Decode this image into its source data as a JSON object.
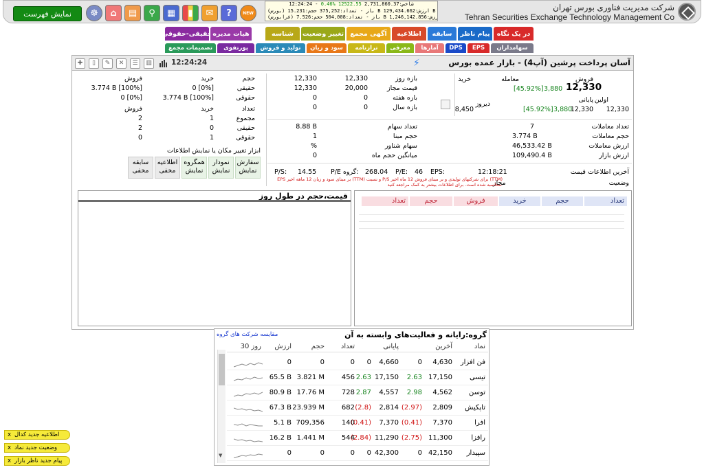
{
  "header": {
    "show_list": "نمایش فهرست",
    "company_fa": "شرکت مدیریت فناوری بورس تهران",
    "company_en": "Tehran Securities Exchange Technology Management Co",
    "ticker": {
      "line1_a": "شاخص:",
      "line1_b": "2,731,860.37",
      "line1_c": "12522.55",
      "line1_d": "%0.46",
      "line1_e": " - 12:24:24",
      "line2": "(بورس) باز - تعداد:375,252 حجم:15.231 B ارزش:129,434.662 B",
      "line3": "(فرابورس) باز - تعداد:504,008 حجم:7.526 B ارزش:1,246,142.856 B"
    },
    "icons": [
      "brain-icon",
      "home-icon",
      "table-icon",
      "search-icon",
      "chart-board-icon",
      "bar-chart-icon",
      "chat-icon",
      "help-icon",
      "new-badge-icon"
    ]
  },
  "menu_row1": [
    "حقیقی-حقوقی",
    "هیات مدیره",
    "شناسه",
    "تغییر وضعیت",
    "آگهی مجمع",
    "اطلاعیه",
    "سابقه",
    "پیام ناظر",
    "در یک نگاه"
  ],
  "menu_row2": [
    "تصمیمات مجمع",
    "پورتفوی",
    "تولید و فروش",
    "سود و زیان",
    "ترازنامه",
    "معرفی",
    "آمارها",
    "DPS",
    "EPS",
    "سهامداران"
  ],
  "stock": {
    "title": "آسان پرداخت پرشین (آپ4) - بازار عمده بورس",
    "time": "12:24:24"
  },
  "price_info": {
    "labels": {
      "trade": "معامله",
      "sell": "فروش",
      "buy": "خرید",
      "first": "اولین",
      "last": "پایانی",
      "yesterday": "دیروز"
    },
    "last_price": "12,330",
    "last_change": "3,880",
    "last_pct": "[45.92%]",
    "close_price": "12,330",
    "close_change": "3,880",
    "close_pct": "[45.92%]",
    "first_price": "12,330",
    "yesterday": "8,450",
    "trade_count_label": "تعداد معاملات",
    "trade_count": "7",
    "volume_label": "حجم معاملات",
    "volume": "3.774 B",
    "value_label": "ارزش معاملات",
    "value": "46,533.42 B",
    "market_label": "ارزش بازار",
    "market": "109,490.4 B",
    "last_update_label": "آخرین اطلاعات قیمت",
    "last_update": "12:18:21",
    "status_label": "وضعیت",
    "status": "مجاز"
  },
  "ranges": {
    "day_label": "بازه روز",
    "day_min": "12,330",
    "day_max": "12,330",
    "allowed_label": "قیمت مجاز",
    "allowed_min": "20,000",
    "allowed_max": "12,330",
    "week_label": "بازه هفته",
    "week_min": "0",
    "week_max": "0",
    "year_label": "بازه سال",
    "year_min": "0",
    "year_max": "0",
    "shares_label": "تعداد سهام",
    "shares": "8.88 B",
    "base_vol_label": "حجم مبنا",
    "base_vol": "1",
    "float_label": "سهام شناور",
    "float": "%",
    "avg_label": "میانگین حجم ماه",
    "avg": "0",
    "eps_label": "EPS:",
    "eps": "46",
    "pe_label": "P/E:",
    "pe": "268.04",
    "gpe_label": "P/E گروه:",
    "gpe": "14.55",
    "ps_label": "P/S:",
    "ps": "",
    "note": "EPS بر مبنای سود و زیان 12 ماهه اخیر (TTM) و نسبت P/S برای شرکتهای تولیدی و بر مبنای فروش 12 ماه اخیر (TTM) محاسبه شده است. برای اطلاعات بیشتر به کمک مراجعه کنید."
  },
  "real_legal": {
    "buy": "خرید",
    "sell": "فروش",
    "volume": "حجم",
    "count": "تعداد",
    "real": "حقیقی",
    "legal": "حقوقی",
    "total": "مجموع",
    "vol_real_buy": "0 [0%]",
    "vol_real_sell": "3.774 B [100%]",
    "vol_legal_buy": "3.774 B [100%]",
    "vol_legal_sell": "0 [0%]",
    "cnt_total_buy": "1",
    "cnt_total_sell": "2",
    "cnt_real_buy": "0",
    "cnt_real_sell": "2",
    "cnt_legal_buy": "1",
    "cnt_legal_sell": "0"
  },
  "tools": {
    "title": "ابزار تغییر مکان یا نمایش اطلاعات",
    "buttons": [
      {
        "top": "سفارش",
        "bottom": "نمایش"
      },
      {
        "top": "نمودار",
        "bottom": "نمایش"
      },
      {
        "top": "همگروه",
        "bottom": "نمایش"
      },
      {
        "top": "اطلاعیه",
        "bottom": "مخفی"
      },
      {
        "top": "سابقه",
        "bottom": "مخفی"
      }
    ]
  },
  "chart_panel": {
    "title": "قیمت،حجم در طول روز"
  },
  "order_book": {
    "headers": [
      "تعداد",
      "حجم",
      "خرید",
      "فروش",
      "حجم",
      "تعداد"
    ]
  },
  "group": {
    "title": "گروه:رایانه و فعالیت‌های وابسته به آن",
    "compare": "مقایسه شرکت های گروه",
    "headers": [
      "نماد",
      "آخرین",
      "پایانی",
      "تعداد",
      "حجم",
      "ارزش",
      "30 روز"
    ],
    "rows": [
      {
        "symbol": "فن افزار",
        "last": "4,630",
        "last_ch": "0",
        "close": "4,660",
        "close_ch": "0",
        "count": "0",
        "volume": "0",
        "value": "0",
        "last_cls": "",
        "close_cls": ""
      },
      {
        "symbol": "تیسی",
        "last": "17,150",
        "last_ch": "2.63",
        "close": "17,150",
        "close_ch": "2.63",
        "count": "456",
        "volume": "3.821 M",
        "value": "65.5 B",
        "last_cls": "green",
        "close_cls": "green"
      },
      {
        "symbol": "توسن",
        "last": "4,562",
        "last_ch": "2.98",
        "close": "4,557",
        "close_ch": "2.87",
        "count": "728",
        "volume": "17.76 M",
        "value": "80.9 B",
        "last_cls": "green",
        "close_cls": "green"
      },
      {
        "symbol": "تاپکیش",
        "last": "2,809",
        "last_ch": "(2.97)",
        "close": "2,814",
        "close_ch": "(2.8)",
        "count": "682",
        "volume": "23.939 M",
        "value": "67.3 B",
        "last_cls": "red",
        "close_cls": "red"
      },
      {
        "symbol": "افرا",
        "last": "7,370",
        "last_ch": "(0.41)",
        "close": "7,370",
        "close_ch": "(0.41)",
        "count": "140",
        "volume": "709,356",
        "value": "5.1 B",
        "last_cls": "red",
        "close_cls": "red"
      },
      {
        "symbol": "رافزا",
        "last": "11,300",
        "last_ch": "(2.75)",
        "close": "11,290",
        "close_ch": "(2.84)",
        "count": "544",
        "volume": "1.441 M",
        "value": "16.2 B",
        "last_cls": "red",
        "close_cls": "red"
      },
      {
        "symbol": "سپیدار",
        "last": "42,150",
        "last_ch": "0",
        "close": "42,300",
        "close_ch": "0",
        "count": "0",
        "volume": "0",
        "value": "0",
        "last_cls": "",
        "close_cls": ""
      }
    ]
  },
  "notifications": [
    "اطلاعیه جدید کدال",
    "وضعیت جدید نماد",
    "پیام جدید ناظر بازار"
  ],
  "colors": {
    "header_bg": "#e6e6e6",
    "show_list_bg": "#138a13",
    "positive": "#12821a",
    "negative": "#d01212",
    "notif_bg": "#f6ea3a"
  }
}
